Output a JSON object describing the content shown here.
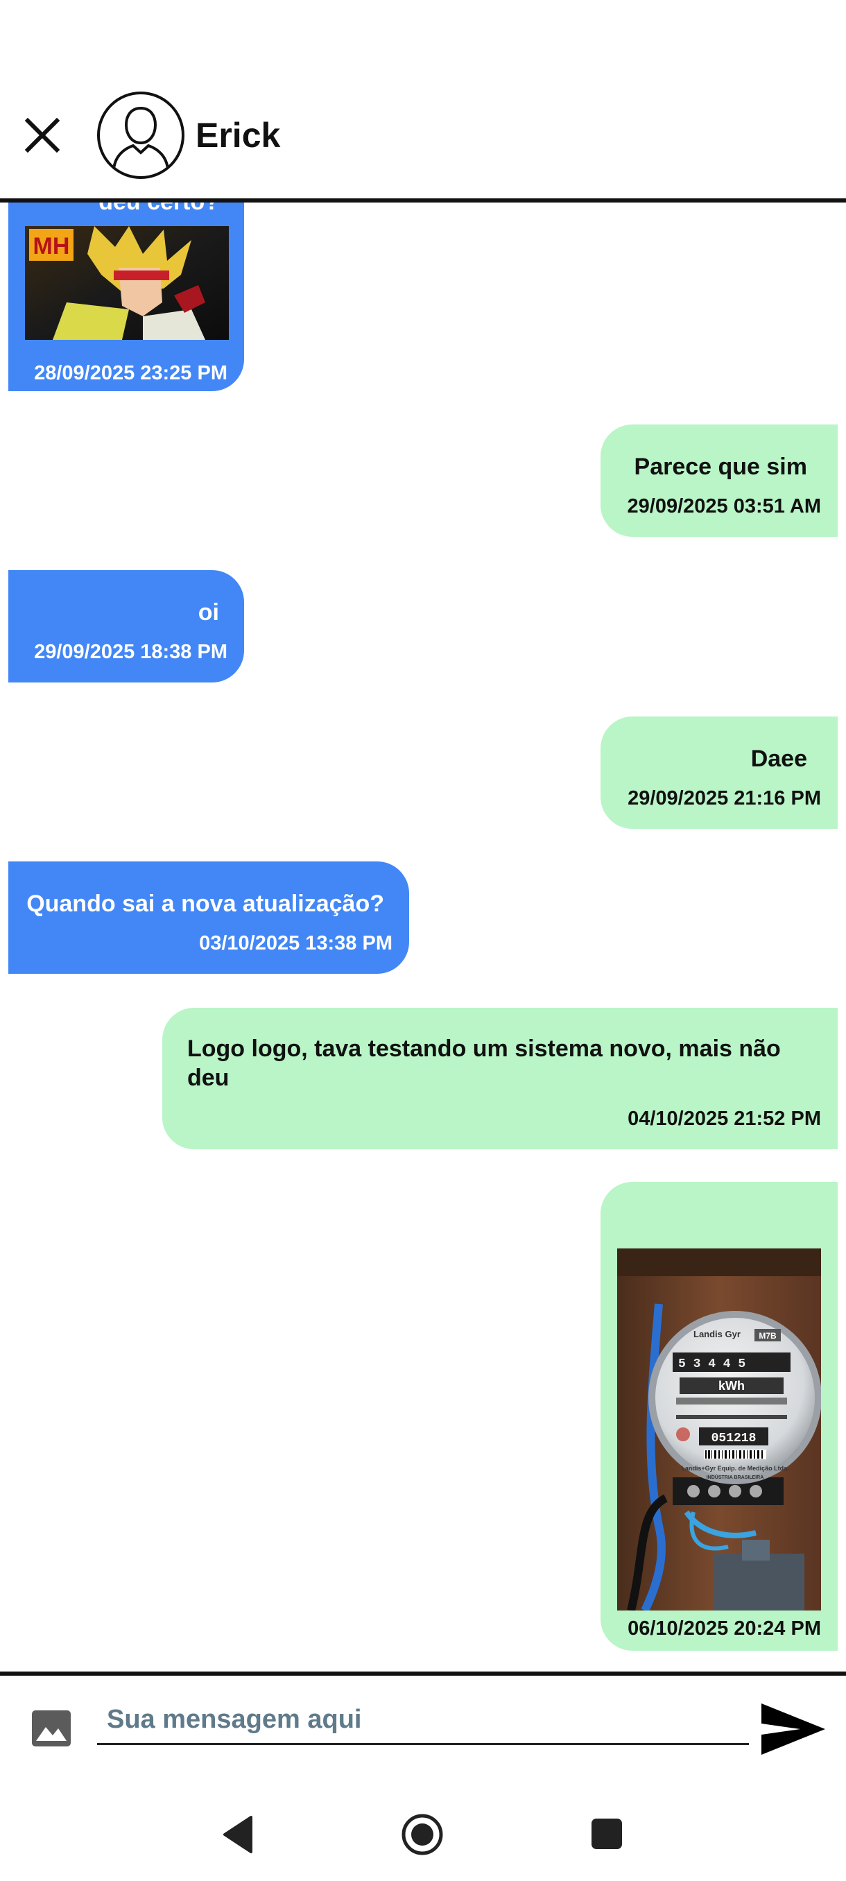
{
  "header": {
    "contact_name": "Erick"
  },
  "messages": [
    {
      "side": "left",
      "type": "image",
      "text": "deu certo?",
      "time": "28/09/2025 23:25 PM",
      "image_text": "MH"
    },
    {
      "side": "right",
      "type": "text",
      "text": "Parece que sim",
      "time": "29/09/2025 03:51 AM"
    },
    {
      "side": "left",
      "type": "text",
      "text": "oi",
      "time": "29/09/2025 18:38 PM"
    },
    {
      "side": "right",
      "type": "text",
      "text": "Daee",
      "time": "29/09/2025 21:16 PM"
    },
    {
      "side": "left",
      "type": "text",
      "text": "Quando sai a nova atualização?",
      "time": "03/10/2025 13:38 PM"
    },
    {
      "side": "right",
      "type": "text",
      "text": "Logo logo, tava testando um sistema novo, mais não deu",
      "time": "04/10/2025 21:52 PM"
    },
    {
      "side": "right",
      "type": "image",
      "time": "06/10/2025 20:24 PM",
      "meter": {
        "brand": "Landis Gyr",
        "model": "M7B",
        "reading": "5 3 4 4 5",
        "unit": "kWh",
        "serial": "051218",
        "footer": "Landis+Gyr Equip. de Medição Ltda.",
        "footer2": "INDÚSTRIA BRASILEIRA"
      }
    }
  ],
  "composer": {
    "placeholder": "Sua mensagem aqui"
  },
  "colors": {
    "received_bubble": "#4287f5",
    "sent_bubble": "#b9f5c7",
    "divider": "#111111"
  }
}
